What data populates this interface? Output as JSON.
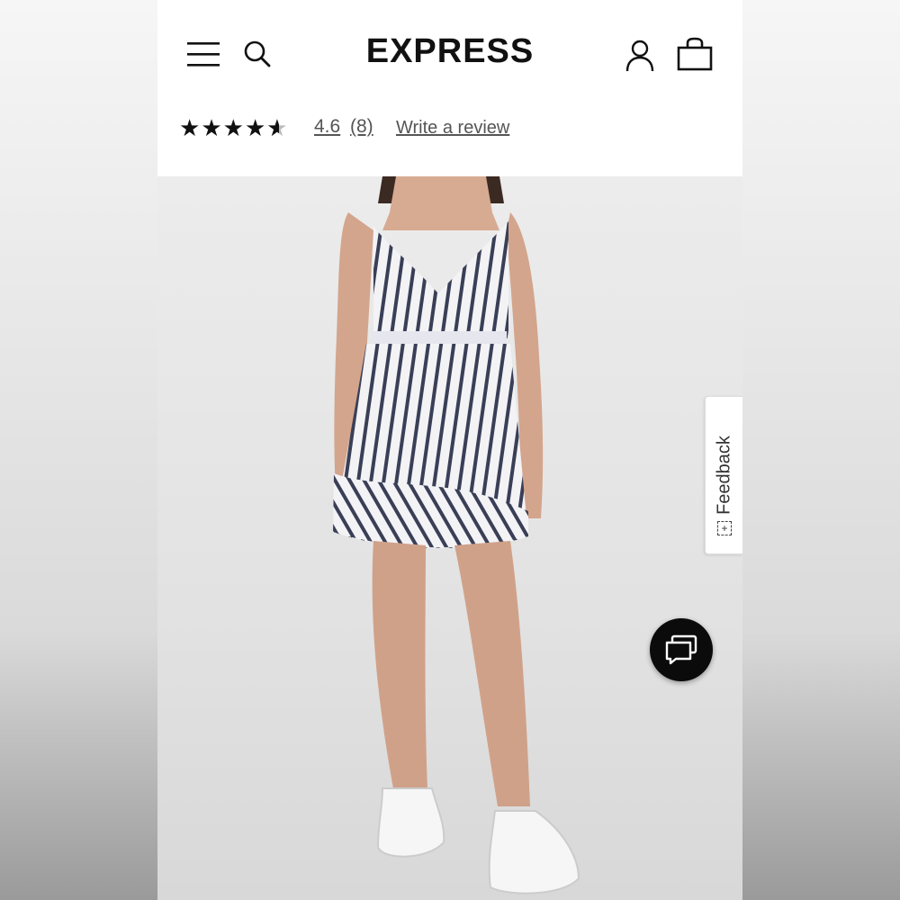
{
  "header": {
    "logo_text": "EXPRESS",
    "menu_icon": "hamburger-menu-icon",
    "search_icon": "search-icon",
    "account_icon": "person-icon",
    "bag_icon": "shopping-bag-icon"
  },
  "rating": {
    "stars": 4.6,
    "value": "4.6",
    "count": "(8)",
    "write_review_label": "Write a review"
  },
  "product_image": {
    "alt_icon": "product-photo"
  },
  "feedback": {
    "label": "Feedback",
    "icon": "plus-icon"
  },
  "chat": {
    "icon": "chat-bubbles-icon"
  }
}
